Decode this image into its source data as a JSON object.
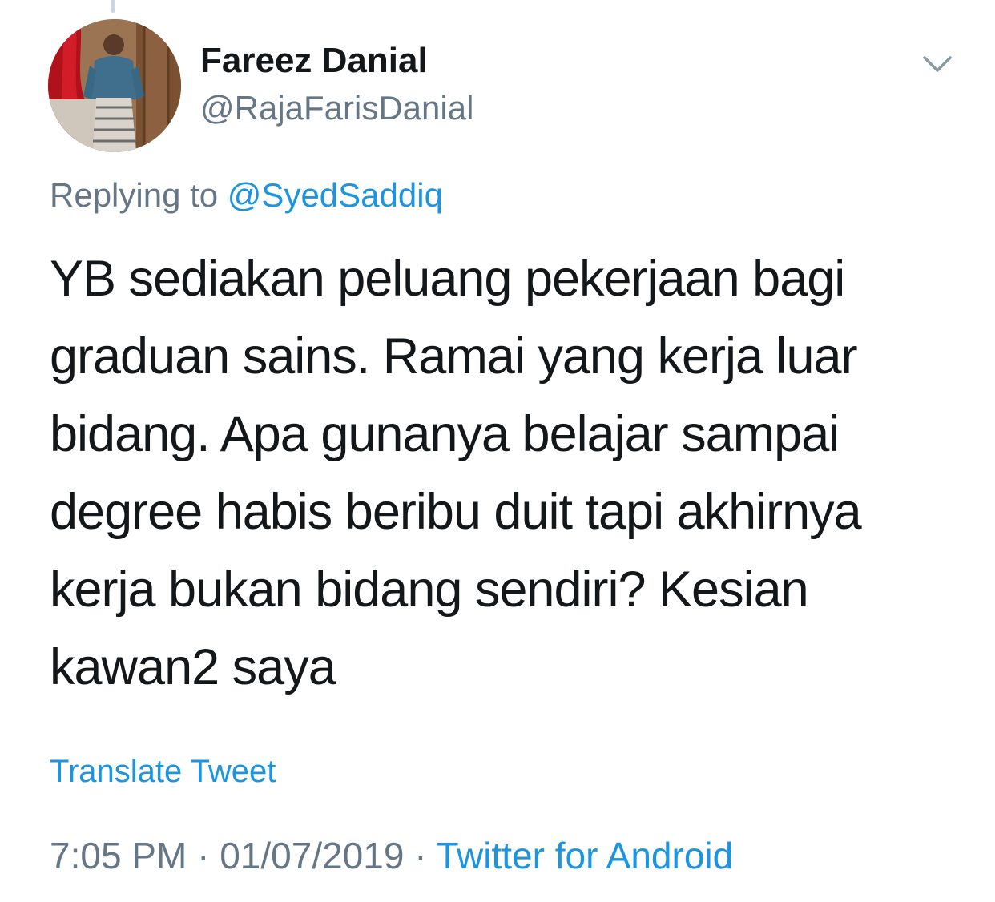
{
  "tweet": {
    "display_name": "Fareez Danial",
    "handle": "@RajaFarisDanial",
    "replying_prefix": "Replying to",
    "replying_mention": "@SyedSaddiq",
    "text_lines": [
      "YB sediakan peluang pekerjaan bagi",
      "graduan sains. Ramai yang kerja luar",
      "bidang. Apa gunanya belajar sampai",
      "degree habis beribu duit tapi akhirnya",
      "kerja bukan bidang sendiri? Kesian",
      "kawan2 saya"
    ],
    "translate_label": "Translate Tweet",
    "time": "7:05 PM",
    "separator": "·",
    "date": "01/07/2019",
    "source": "Twitter for Android"
  },
  "icons": {
    "menu": "chevron-down-icon"
  },
  "colors": {
    "text": "#14171a",
    "secondary": "#657786",
    "link": "#1b95e0"
  }
}
